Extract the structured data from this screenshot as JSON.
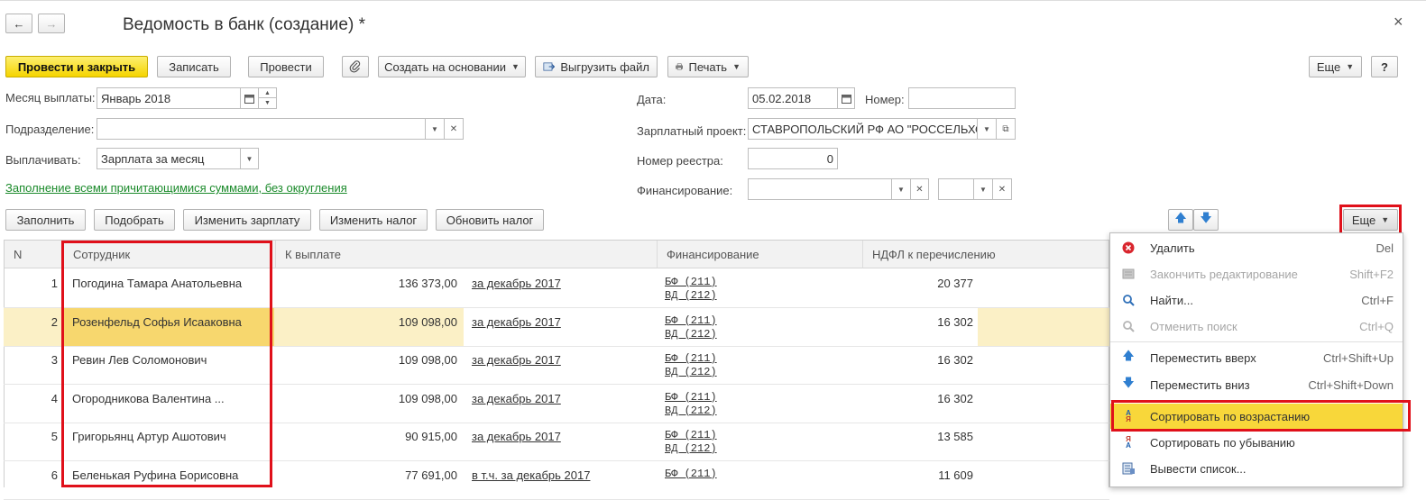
{
  "window": {
    "title": "Ведомость в банк (создание) *",
    "back": "←",
    "forward": "→",
    "close": "×"
  },
  "toolbar": {
    "post_close": "Провести и закрыть",
    "save": "Записать",
    "post": "Провести",
    "create_based": "Создать на основании",
    "export_file": "Выгрузить файл",
    "print": "Печать",
    "more": "Еще",
    "help": "?"
  },
  "form": {
    "month_label": "Месяц выплаты:",
    "month_value": "Январь 2018",
    "dept_label": "Подразделение:",
    "dept_value": "",
    "pay_label": "Выплачивать:",
    "pay_value": "Зарплата за месяц",
    "fill_link": "Заполнение всеми причитающимися суммами, без округления",
    "date_label": "Дата:",
    "date_value": "05.02.2018",
    "number_label": "Номер:",
    "number_value": "",
    "project_label": "Зарплатный проект:",
    "project_value": "СТАВРОПОЛЬСКИЙ РФ АО \"РОССЕЛЬХОЗ",
    "registry_label": "Номер реестра:",
    "registry_value": "0",
    "financing_label": "Финансирование:",
    "financing_value": "",
    "financing_value2": ""
  },
  "table_toolbar": {
    "fill": "Заполнить",
    "pick": "Подобрать",
    "change_salary": "Изменить зарплату",
    "change_tax": "Изменить налог",
    "update_tax": "Обновить налог",
    "more": "Еще"
  },
  "table": {
    "columns": [
      "N",
      "Сотрудник",
      "К выплате",
      "Финансирование",
      "НДФЛ к перечислению"
    ],
    "rows": [
      {
        "n": "1",
        "employee": "Погодина Тамара Анатольевна",
        "amount": "136 373,00",
        "period": "за декабрь 2017",
        "fin1": "БФ (211)",
        "fin2": "ВД (212)",
        "ndfl": "20 377"
      },
      {
        "n": "2",
        "employee": "Розенфельд Софья Исааковна",
        "amount": "109 098,00",
        "period": "за декабрь 2017",
        "fin1": "БФ (211)",
        "fin2": "ВД (212)",
        "ndfl": "16 302"
      },
      {
        "n": "3",
        "employee": "Ревин Лев Соломонович",
        "amount": "109 098,00",
        "period": "за декабрь 2017",
        "fin1": "БФ (211)",
        "fin2": "ВД (212)",
        "ndfl": "16 302"
      },
      {
        "n": "4",
        "employee": "Огородникова Валентина ...",
        "amount": "109 098,00",
        "period": "за декабрь 2017",
        "fin1": "БФ (211)",
        "fin2": "ВД (212)",
        "ndfl": "16 302"
      },
      {
        "n": "5",
        "employee": "Григорьянц Артур Ашотович",
        "amount": "90 915,00",
        "period": "за декабрь 2017",
        "fin1": "БФ (211)",
        "fin2": "ВД (212)",
        "ndfl": "13 585"
      },
      {
        "n": "6",
        "employee": "Беленькая Руфина Борисовна",
        "amount": "77 691,00",
        "period": "в т.ч. за декабрь 2017",
        "fin1": "БФ (211)",
        "fin2": "",
        "ndfl": "11 609"
      }
    ]
  },
  "menu": {
    "items": [
      {
        "label": "Удалить",
        "shortcut": "Del",
        "icon": "delete-icon",
        "disabled": false
      },
      {
        "label": "Закончить редактирование",
        "shortcut": "Shift+F2",
        "icon": "finish-edit-icon",
        "disabled": true
      },
      {
        "label": "Найти...",
        "shortcut": "Ctrl+F",
        "icon": "search-icon",
        "disabled": false
      },
      {
        "label": "Отменить поиск",
        "shortcut": "Ctrl+Q",
        "icon": "cancel-search-icon",
        "disabled": true
      },
      {
        "label": "Переместить вверх",
        "shortcut": "Ctrl+Shift+Up",
        "icon": "arrow-up-icon",
        "disabled": false
      },
      {
        "label": "Переместить вниз",
        "shortcut": "Ctrl+Shift+Down",
        "icon": "arrow-down-icon",
        "disabled": false
      },
      {
        "label": "Сортировать по возрастанию",
        "shortcut": "",
        "icon": "sort-asc-icon",
        "disabled": false
      },
      {
        "label": "Сортировать по убыванию",
        "shortcut": "",
        "icon": "sort-desc-icon",
        "disabled": false
      },
      {
        "label": "Вывести список...",
        "shortcut": "",
        "icon": "list-output-icon",
        "disabled": false
      }
    ]
  },
  "colors": {
    "accent_yellow": "#f5d400",
    "highlight_red": "#e0101a",
    "link_green": "#1a8a2a",
    "selected_row": "#fbf0c6"
  }
}
